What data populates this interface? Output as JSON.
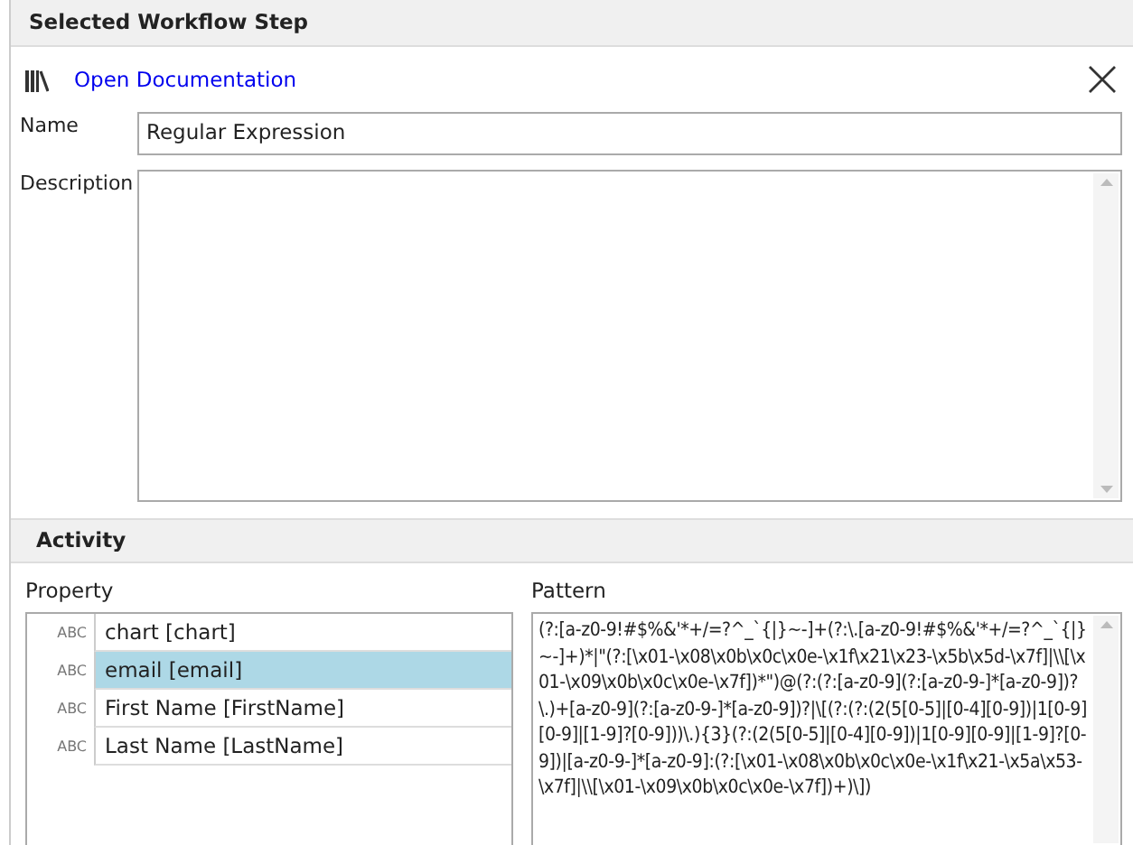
{
  "panel_title": "Selected Workflow Step",
  "toolbar": {
    "link": "Open Documentation"
  },
  "name_field": {
    "label": "Name",
    "value": "Regular Expression"
  },
  "description_field": {
    "label": "Description"
  },
  "activity": {
    "title": "Activity",
    "property_label": "Property",
    "pattern_label": "Pattern",
    "properties": [
      {
        "type_tag": "ABC",
        "label": "chart [chart]",
        "selected": false
      },
      {
        "type_tag": "ABC",
        "label": "email [email]",
        "selected": true
      },
      {
        "type_tag": "ABC",
        "label": "First Name [FirstName]",
        "selected": false
      },
      {
        "type_tag": "ABC",
        "label": "Last Name [LastName]",
        "selected": false
      }
    ],
    "pattern": "(?:[a-z0-9!#$%&'*+/=?^_`{|}~-]+(?:\\.[a-z0-9!#$%&'*+/=?^_`{|}~-]+)*|\"(?:[\\x01-\\x08\\x0b\\x0c\\x0e-\\x1f\\x21\\x23-\\x5b\\x5d-\\x7f]|\\\\[\\x01-\\x09\\x0b\\x0c\\x0e-\\x7f])*\")@(?:(?:[a-z0-9](?:[a-z0-9-]*[a-z0-9])?\\.)+[a-z0-9](?:[a-z0-9-]*[a-z0-9])?|\\[(?:(?:(2(5[0-5]|[0-4][0-9])|1[0-9][0-9]|[1-9]?[0-9]))\\.){3}(?:(2(5[0-5]|[0-4][0-9])|1[0-9][0-9]|[1-9]?[0-9])|[a-z0-9-]*[a-z0-9]:(?:[\\x01-\\x08\\x0b\\x0c\\x0e-\\x1f\\x21-\\x5a\\x53-\\x7f]|\\\\[\\x01-\\x09\\x0b\\x0c\\x0e-\\x7f])+)\\])"
  }
}
